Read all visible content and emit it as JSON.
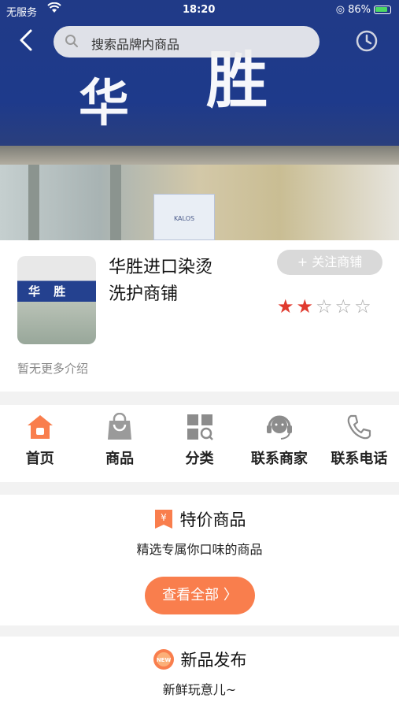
{
  "status_bar": {
    "carrier": "无服务",
    "time": "18:20",
    "battery": "86%"
  },
  "search": {
    "placeholder": "搜索品牌内商品"
  },
  "banner": {
    "sign_left": "华",
    "sign_right": "胜",
    "poster": "KALOS"
  },
  "shop": {
    "name": "华胜进口染烫洗护商铺",
    "follow_label": "+ 关注商铺",
    "rating": 2,
    "rating_max": 5,
    "intro": "暂无更多介绍",
    "logo_text": "华 胜"
  },
  "nav": [
    {
      "label": "首页",
      "icon": "home-icon"
    },
    {
      "label": "商品",
      "icon": "bag-icon"
    },
    {
      "label": "分类",
      "icon": "category-icon"
    },
    {
      "label": "联系商家",
      "icon": "headset-icon"
    },
    {
      "label": "联系电话",
      "icon": "phone-icon"
    }
  ],
  "special": {
    "title": "特价商品",
    "subtitle": "精选专属你口味的商品",
    "button": "查看全部 〉"
  },
  "new_release": {
    "title": "新品发布",
    "subtitle": "新鲜玩意儿~"
  },
  "colors": {
    "accent": "#f97e4d",
    "star": "#e03a2e",
    "banner_blue": "#203a87"
  }
}
